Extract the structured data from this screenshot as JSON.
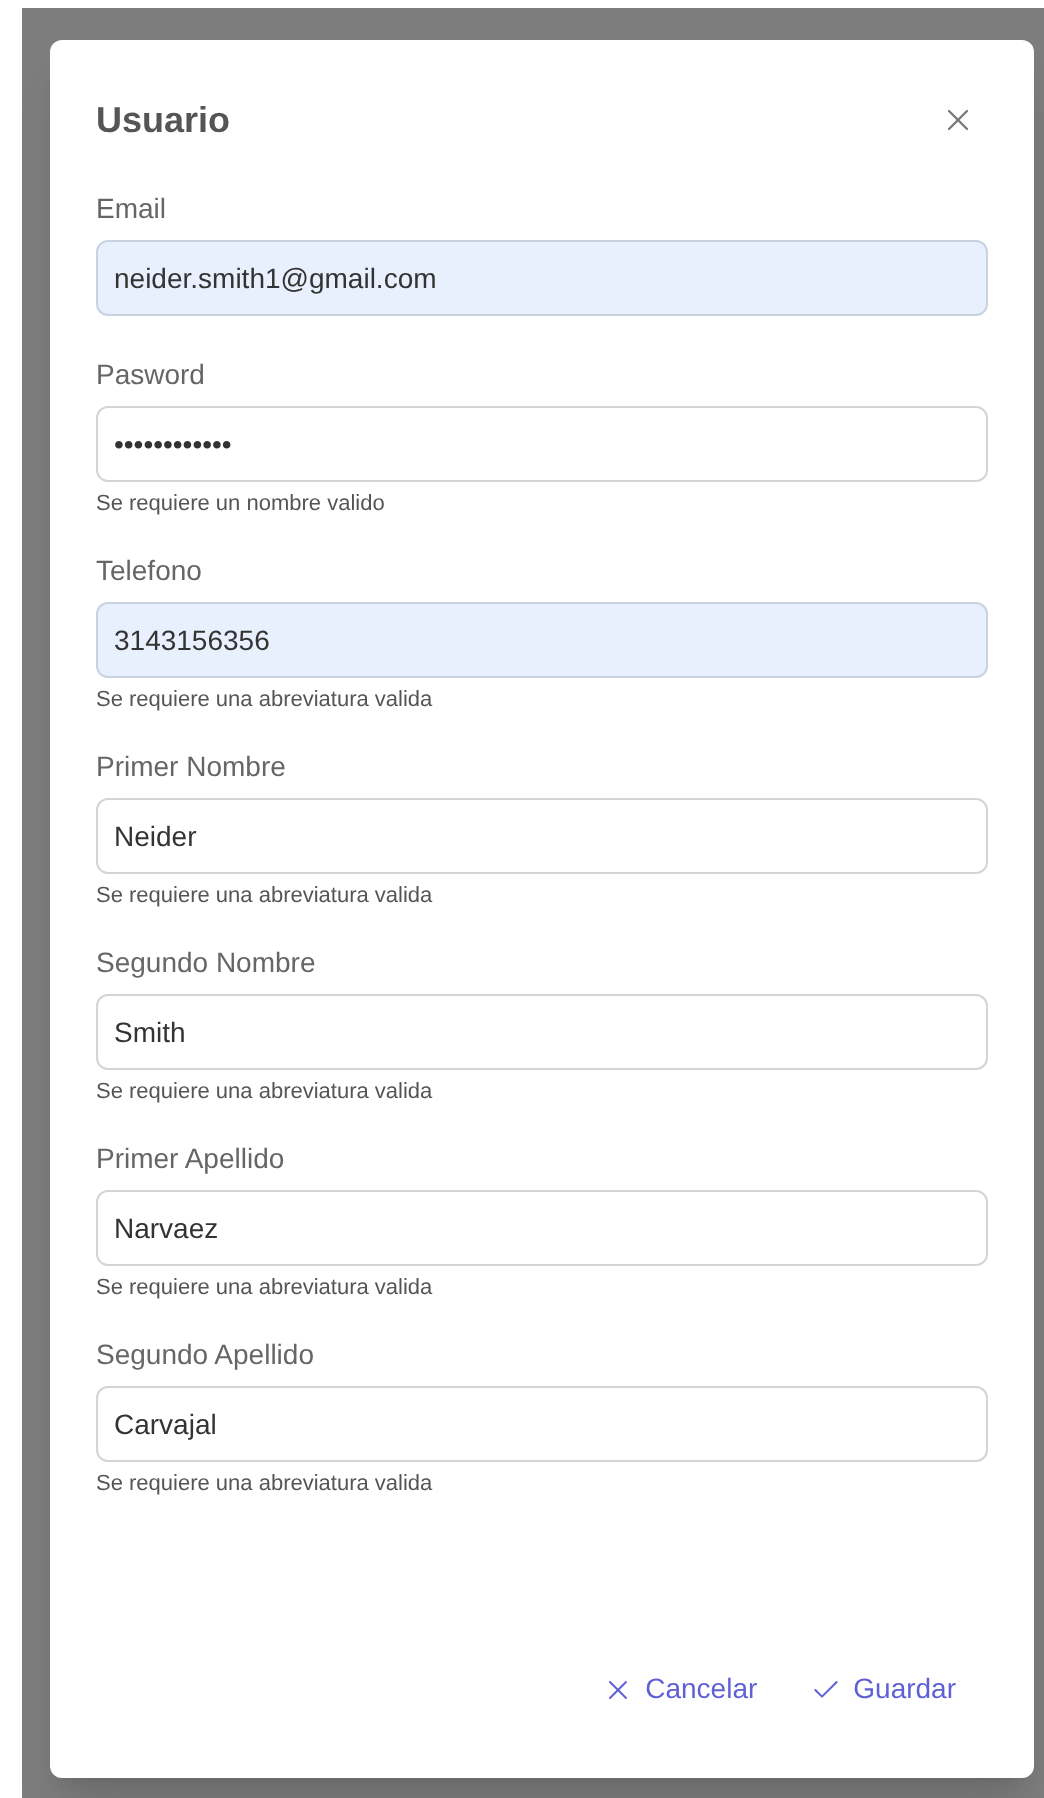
{
  "dialog": {
    "title": "Usuario"
  },
  "fields": [
    {
      "label": "Email",
      "value": "neider.smith1@gmail.com",
      "autofilled": true
    },
    {
      "label": "Pasword",
      "value": "••••••••••••",
      "autofilled": false,
      "hint": "Se requiere un nombre valido"
    },
    {
      "label": "Telefono",
      "value": "3143156356",
      "autofilled": true,
      "hint": "Se requiere una abreviatura valida"
    },
    {
      "label": "Primer Nombre",
      "value": "Neider",
      "autofilled": false,
      "hint": "Se requiere una abreviatura valida"
    },
    {
      "label": "Segundo Nombre",
      "value": "Smith",
      "autofilled": false,
      "hint": "Se requiere una abreviatura valida"
    },
    {
      "label": "Primer Apellido",
      "value": "Narvaez",
      "autofilled": false,
      "hint": "Se requiere una abreviatura valida"
    },
    {
      "label": "Segundo Apellido",
      "value": "Carvajal",
      "autofilled": false,
      "hint": "Se requiere una abreviatura valida"
    }
  ],
  "buttons": [
    {
      "label": "Cancelar",
      "kind": "cancel"
    },
    {
      "label": "Guardar",
      "kind": "save"
    }
  ]
}
